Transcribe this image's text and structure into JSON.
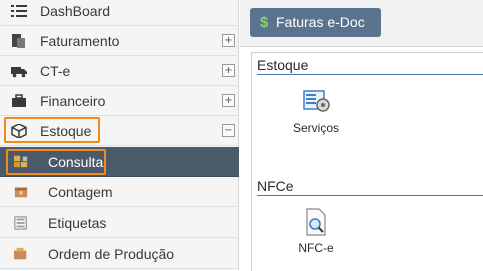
{
  "sidebar": {
    "items": [
      {
        "label": "DashBoard",
        "icon": "list-icon"
      },
      {
        "label": "Faturamento",
        "icon": "documents-icon",
        "toggle": "+"
      },
      {
        "label": "CT-e",
        "icon": "truck-icon",
        "toggle": "+"
      },
      {
        "label": "Financeiro",
        "icon": "briefcase-icon",
        "toggle": "+"
      },
      {
        "label": "Estoque",
        "icon": "cube-icon",
        "toggle": "−"
      },
      {
        "label": "Consulta",
        "icon": "warehouse-boxes-icon"
      },
      {
        "label": "Contagem",
        "icon": "box-icon"
      },
      {
        "label": "Etiquetas",
        "icon": "label-sheet-icon"
      },
      {
        "label": "Ordem de Produção",
        "icon": "production-order-icon"
      }
    ]
  },
  "toolbar": {
    "faturas_label": "Faturas e-Doc",
    "faturas_symbol": "$"
  },
  "sections": [
    {
      "title": "Estoque",
      "tiles": [
        {
          "label": "Serviços",
          "icon": "services-icon"
        }
      ]
    },
    {
      "title": "NFCe",
      "tiles": [
        {
          "label": "NFC-e",
          "icon": "nfce-document-icon"
        }
      ]
    }
  ],
  "colors": {
    "highlight": "#f08a1c",
    "active_bg": "#4b5a6a",
    "button_bg": "#5a7490",
    "section_line": "#4d79b3"
  }
}
